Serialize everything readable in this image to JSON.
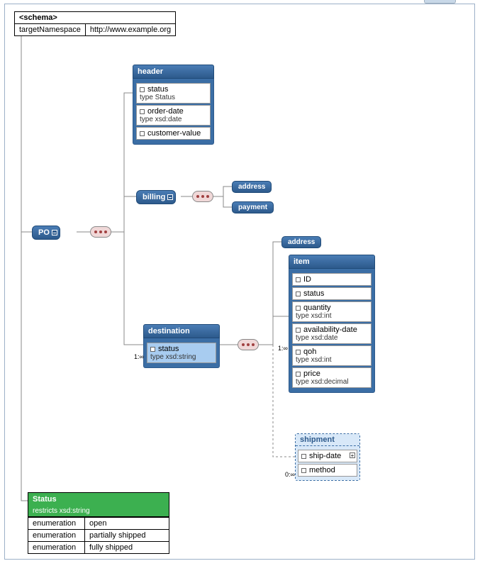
{
  "schema": {
    "tag": "<schema>",
    "ns_label": "targetNamespace",
    "ns_value": "http://www.example.org"
  },
  "po": {
    "label": "PO"
  },
  "header": {
    "title": "header",
    "attrs": [
      {
        "name": "status",
        "type": "type Status"
      },
      {
        "name": "order-date",
        "type": "type xsd:date"
      },
      {
        "name": "customer-value",
        "type": ""
      }
    ]
  },
  "billing": {
    "label": "billing",
    "children": [
      {
        "label": "address"
      },
      {
        "label": "payment"
      }
    ]
  },
  "destination": {
    "title": "destination",
    "card": "1:∞",
    "attr": {
      "name": "status",
      "type": "type xsd:string"
    },
    "address": {
      "label": "address"
    },
    "item": {
      "title": "item",
      "card": "1:∞",
      "attrs": [
        {
          "name": "ID",
          "type": ""
        },
        {
          "name": "status",
          "type": ""
        },
        {
          "name": "quantity",
          "type": "type xsd:int"
        },
        {
          "name": "availability-date",
          "type": "type xsd:date"
        },
        {
          "name": "qoh",
          "type": "type xsd:int"
        },
        {
          "name": "price",
          "type": "type xsd:decimal"
        }
      ]
    },
    "shipment": {
      "title": "shipment",
      "card": "0:∞",
      "attrs": [
        {
          "name": "ship-date"
        },
        {
          "name": "method"
        }
      ]
    }
  },
  "status_type": {
    "title": "Status",
    "restricts": "restricts xsd:string",
    "rows": [
      {
        "facet": "enumeration",
        "value": "open"
      },
      {
        "facet": "enumeration",
        "value": "partially shipped"
      },
      {
        "facet": "enumeration",
        "value": "fully shipped"
      }
    ]
  }
}
